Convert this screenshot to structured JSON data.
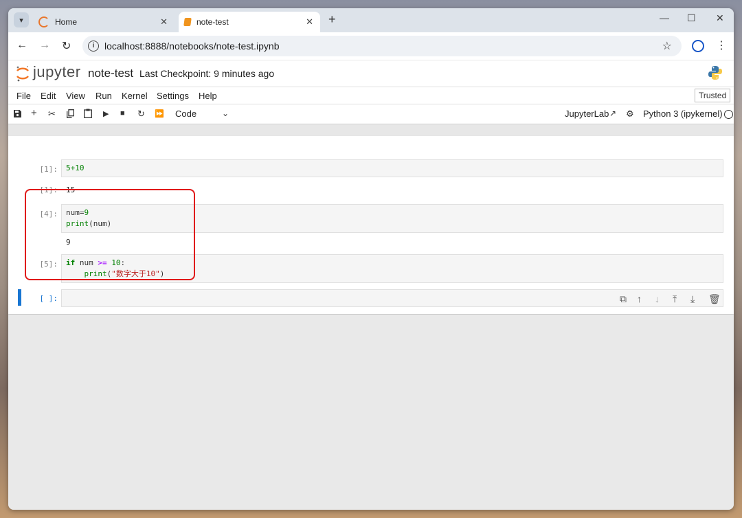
{
  "browser": {
    "tabs": [
      {
        "title": "Home"
      },
      {
        "title": "note-test"
      }
    ],
    "url": "localhost:8888/notebooks/note-test.ipynb"
  },
  "jupyter": {
    "logo_text": "jupyter",
    "notebook_name": "note-test",
    "checkpoint": "Last Checkpoint: 9 minutes ago",
    "menu": [
      "File",
      "Edit",
      "View",
      "Run",
      "Kernel",
      "Settings",
      "Help"
    ],
    "trusted": "Trusted",
    "cell_type": "Code",
    "jupyterlab_link": "JupyterLab",
    "kernel_name": "Python 3 (ipykernel)"
  },
  "cells": [
    {
      "prompt": "[1]:",
      "code": "5+10",
      "out_prompt": "[1]:",
      "output": "15"
    },
    {
      "prompt": "[4]:",
      "code_l1_a": "num=",
      "code_l1_b": "9",
      "code_l2_a": "print",
      "code_l2_b": "(num)",
      "output": "9"
    },
    {
      "prompt": "[5]:",
      "code_l1_kw": "if",
      "code_l1_a": " num ",
      "code_l1_op": ">=",
      "code_l1_num": " 10",
      "code_l1_b": ":",
      "code_l2_indent": "    ",
      "code_l2_fn": "print",
      "code_l2_p": "(",
      "code_l2_str": "\"数字大于10\"",
      "code_l2_close": ")"
    },
    {
      "prompt": "[ ]:"
    }
  ],
  "icons": {
    "toolbar": [
      "save-icon",
      "add-icon",
      "cut-icon",
      "copy-icon",
      "paste-icon",
      "run-icon",
      "stop-icon",
      "restart-icon",
      "fast-forward-icon"
    ],
    "cell_actions": [
      "duplicate-icon",
      "move-up-icon",
      "move-down-icon",
      "insert-above-icon",
      "insert-below-icon",
      "delete-icon"
    ]
  },
  "colors": {
    "highlight": "#e01a1a",
    "active_cell": "#1976d2",
    "jupyter_orange": "#f37626"
  }
}
